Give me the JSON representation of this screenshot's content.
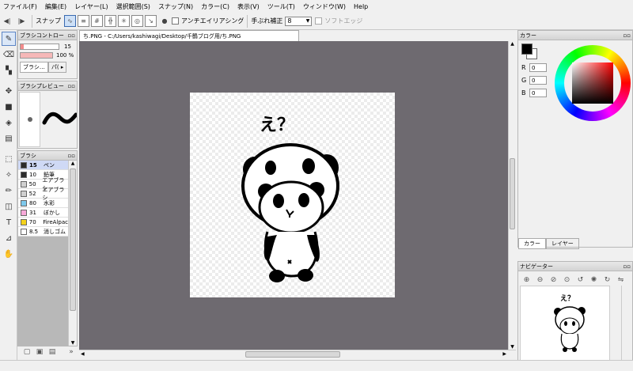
{
  "menu": [
    "ファイル(F)",
    "編集(E)",
    "レイヤー(L)",
    "選択範囲(S)",
    "スナップ(N)",
    "カラー(C)",
    "表示(V)",
    "ツール(T)",
    "ウィンドウ(W)",
    "Help"
  ],
  "toolbar": {
    "snap_label": "スナップ",
    "antialias_label": "アンチエイリアシング",
    "stabilizer_label": "手ぶれ補正",
    "stabilizer_value": "8",
    "soft_edge_label": "ソフトエッジ"
  },
  "brush_control": {
    "title": "ブラシコントロー",
    "size": "15",
    "opacity": "100 %",
    "tab1": "ブラシ…",
    "tab2": "パ( ▸"
  },
  "brush_preview": {
    "title": "ブラシプレビュー"
  },
  "brushes": {
    "title": "ブラシ",
    "items": [
      {
        "size": "15",
        "name": "ペン",
        "color": "#2b2b2b",
        "selected": true
      },
      {
        "size": "10",
        "name": "鉛筆",
        "color": "#2b2b2b",
        "selected": false
      },
      {
        "size": "50",
        "name": "エアブラシ",
        "color": "#d0d0d0",
        "selected": false
      },
      {
        "size": "52",
        "name": "エアブラシ",
        "color": "#d0d0d0",
        "selected": false
      },
      {
        "size": "80",
        "name": "水彩",
        "color": "#7ec9ec",
        "selected": false
      },
      {
        "size": "31",
        "name": "ぼかし",
        "color": "#f7a9d9",
        "selected": false
      },
      {
        "size": "70",
        "name": "FireAlpac",
        "color": "#f4d21b",
        "selected": false
      },
      {
        "size": "8.5",
        "name": "消しゴム",
        "color": "#ffffff",
        "selected": false
      }
    ]
  },
  "document": {
    "tab_title": "ち.PNG - C:/Users/kashiwagi/Desktop/千鶴ブログ用/ち.PNG",
    "caption": "え？"
  },
  "color_panel": {
    "title": "カラー",
    "r": "0",
    "g": "0",
    "b": "0",
    "r_label": "R",
    "g_label": "G",
    "b_label": "B",
    "foreground": "#000000",
    "background": "#ffffff"
  },
  "right_tabs": {
    "color": "カラー",
    "layer": "レイヤー"
  },
  "navigator": {
    "title": "ナビゲーター"
  }
}
